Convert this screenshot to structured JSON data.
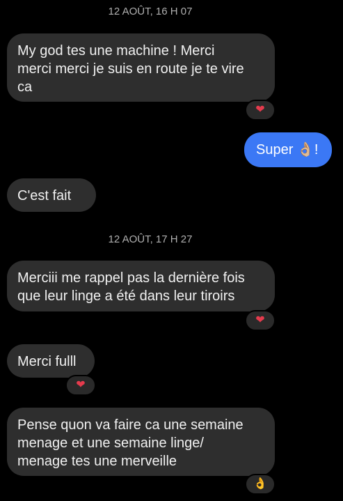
{
  "timestamps": [
    "12 AOÛT, 16 H 07",
    "12 AOÛT, 17 H 27"
  ],
  "messages": [
    {
      "text": "My god tes une machine ! Merci\nmerci merci je suis en route je te vire\nca",
      "reaction": "heart-icon"
    },
    {
      "text": "Super 👌🏼!"
    },
    {
      "text": "C'est fait"
    },
    {
      "text": "Merciii me rappel pas la dernière fois\nque leur linge a été dans leur tiroirs",
      "reaction": "heart-icon"
    },
    {
      "text": "Merci fulll",
      "reaction": "heart-icon"
    },
    {
      "text": "Pense quon va faire ca une semaine\nmenage et une semaine linge/\nmenage tes une merveille",
      "reaction": "ok-hand-icon"
    }
  ],
  "reactions": {
    "heart": "❤",
    "ok": "👌"
  },
  "colors": {
    "background": "#000000",
    "incoming_bubble": "#2e2e2e",
    "outgoing_bubble": "#3b78f5",
    "timestamp": "#b0b0b0"
  }
}
